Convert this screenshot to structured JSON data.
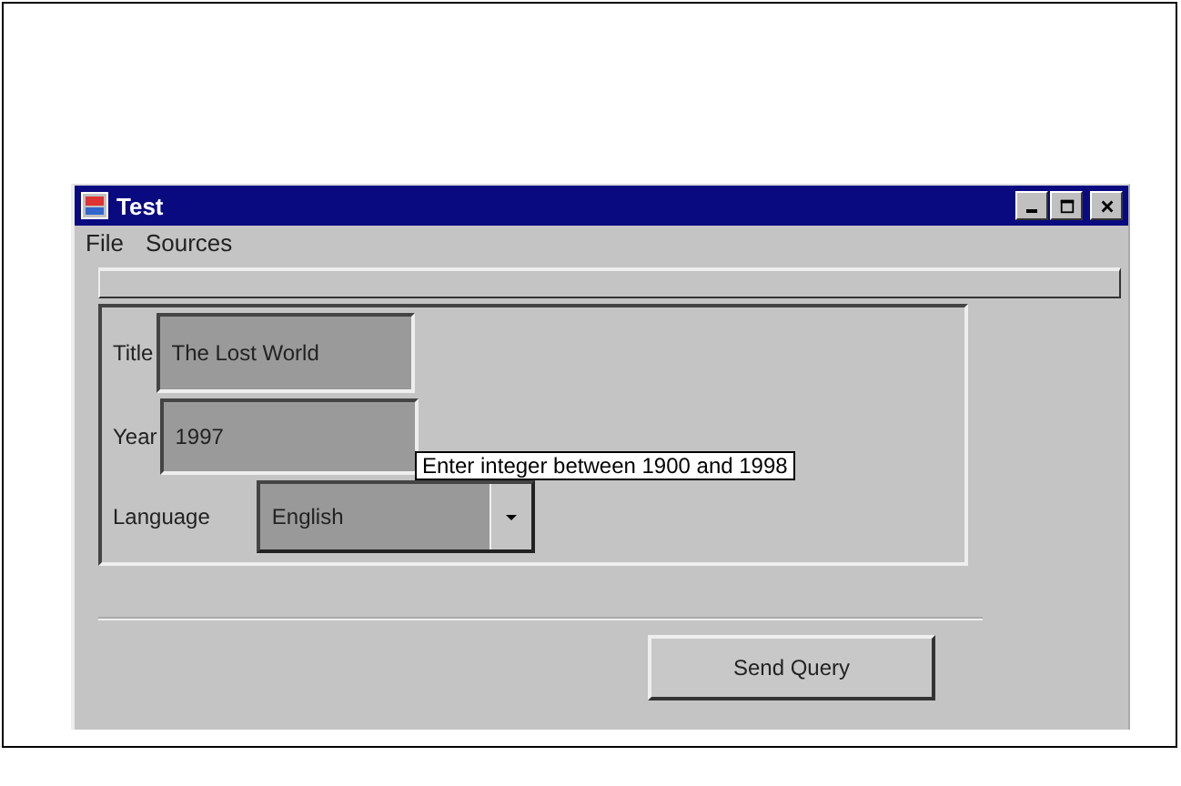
{
  "window": {
    "title": "Test"
  },
  "menu": [
    "File",
    "Sources"
  ],
  "form": {
    "fields": [
      {
        "kind": "text",
        "label": "Title",
        "value": "The Lost World"
      },
      {
        "kind": "text",
        "label": "Year",
        "value": "1997"
      },
      {
        "kind": "combo",
        "label": "Language",
        "value": "English"
      }
    ]
  },
  "tooltip": "Enter integer between 1900 and 1998",
  "buttons": [
    "Send Query"
  ]
}
